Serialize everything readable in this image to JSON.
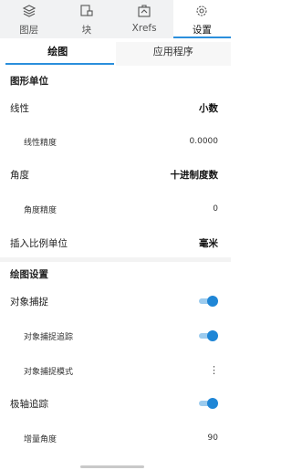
{
  "topnav": {
    "tabs": [
      {
        "label": "图层",
        "icon": "layers-icon"
      },
      {
        "label": "块",
        "icon": "block-icon"
      },
      {
        "label": "Xrefs",
        "icon": "xrefs-icon"
      },
      {
        "label": "设置",
        "icon": "gear-icon",
        "active": true
      }
    ]
  },
  "subtabs": [
    "绘图",
    "应用程序"
  ],
  "units": {
    "header": "图形单位",
    "linear": {
      "label": "线性",
      "value": "小数"
    },
    "linear_precision": {
      "label": "线性精度",
      "value": "0.0000"
    },
    "angle": {
      "label": "角度",
      "value": "十进制度数"
    },
    "angle_precision": {
      "label": "角度精度",
      "value": "0"
    },
    "insert_scale": {
      "label": "插入比例单位",
      "value": "毫米"
    }
  },
  "drawing": {
    "header": "绘图设置",
    "object_snap": {
      "label": "对象捕捉",
      "on": true
    },
    "object_snap_tracking": {
      "label": "对象捕捉追踪",
      "on": true
    },
    "object_snap_mode": {
      "label": "对象捕捉模式"
    },
    "polar_tracking": {
      "label": "极轴追踪",
      "on": true
    },
    "increment_angle": {
      "label": "增量角度",
      "value": "90"
    }
  },
  "colors": {
    "accent": "#2b8fdc",
    "toggle_knob": "#1f86d6",
    "toggle_track": "#9ccbee"
  }
}
